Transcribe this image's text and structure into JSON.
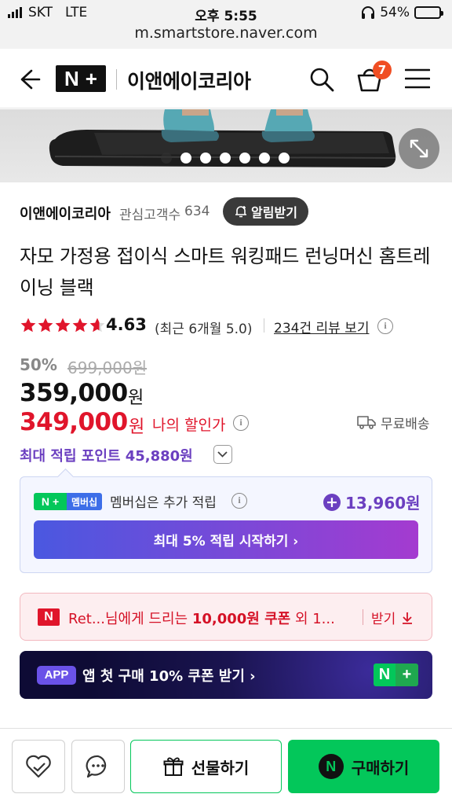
{
  "status_bar": {
    "carrier": "SKT",
    "network": "LTE",
    "time": "오후 5:55",
    "battery": "54%",
    "battery_level": 0.54
  },
  "browser": {
    "url": "m.smartstore.naver.com"
  },
  "header": {
    "logo_text": "N",
    "logo_plus": "+",
    "store_name": "이앤에이코리아",
    "cart_count": "7",
    "icons": [
      "back-arrow-icon",
      "search-icon",
      "cart-icon",
      "menu-icon"
    ]
  },
  "gallery": {
    "dot_count": 7,
    "active_dot": 0
  },
  "seller": {
    "name": "이앤에이코리아",
    "followers_label": "관심고객수",
    "followers_count": "634",
    "alarm_label": "알림받기"
  },
  "product": {
    "title": "자모 가정용 접이식 스마트 워킹패드 런닝머신 홈트레이닝 블랙",
    "rating": "4.63",
    "rating_value": 4.63,
    "recent_rating": "(최근 6개월 5.0)",
    "reviews": "234건 리뷰 보기"
  },
  "price": {
    "discount": "50%",
    "original": "699,000원",
    "sale": "359,000",
    "sale_unit": "원",
    "my_price": "349,000",
    "my_unit": "원",
    "my_label": "나의 할인가",
    "shipping": "무료배송",
    "points": "최대 적립 포인트 45,880원"
  },
  "membership": {
    "badge_label": "멤버십",
    "text": "멤버십은 추가 적립",
    "amount": "13,960원",
    "button": "최대 5% 적립 시작하기 ›"
  },
  "coupon": {
    "prefix": "Ret...님에게 드리는 ",
    "amount": "10,000원 쿠폰",
    "suffix": " 외 1...",
    "download": "받기"
  },
  "app_banner": {
    "badge": "APP",
    "text": "앱 첫 구매 10% 쿠폰 받기 ›"
  },
  "bottom_bar": {
    "gift": "선물하기",
    "buy": "구매하기"
  },
  "colors": {
    "naver_green": "#03c75a",
    "sale_red": "#e0152b",
    "points_purple": "#6b3fc0"
  }
}
